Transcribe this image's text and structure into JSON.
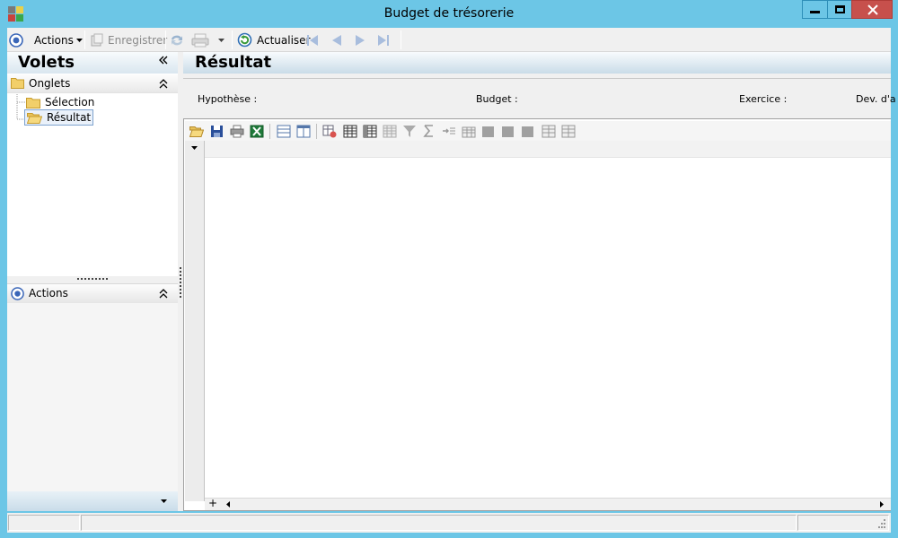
{
  "window": {
    "title": "Budget de trésorerie",
    "controls": [
      "minimize",
      "maximize",
      "close"
    ],
    "colors": {
      "frame": "#6cc6e6",
      "close": "#c7504c"
    }
  },
  "toolbar": {
    "actions_label": "Actions",
    "save_label": "Enregistrer",
    "refresh_label": "Actualiser",
    "nav_icons": [
      "first-icon",
      "previous-icon",
      "next-icon",
      "last-icon"
    ]
  },
  "left_panel": {
    "title": "Volets",
    "sections": {
      "tabs": {
        "label": "Onglets",
        "items": [
          {
            "label": "Sélection",
            "icon": "folder-icon",
            "selected": false
          },
          {
            "label": "Résultat",
            "icon": "folder-open-icon",
            "selected": true
          }
        ]
      },
      "actions": {
        "label": "Actions"
      }
    }
  },
  "main": {
    "title": "Résultat",
    "fields": {
      "hypothesis": "Hypothèse :",
      "budget": "Budget :",
      "fiscal_year": "Exercice :",
      "currency": "Dev. d'a"
    },
    "grid": {
      "add_label": "+"
    }
  }
}
